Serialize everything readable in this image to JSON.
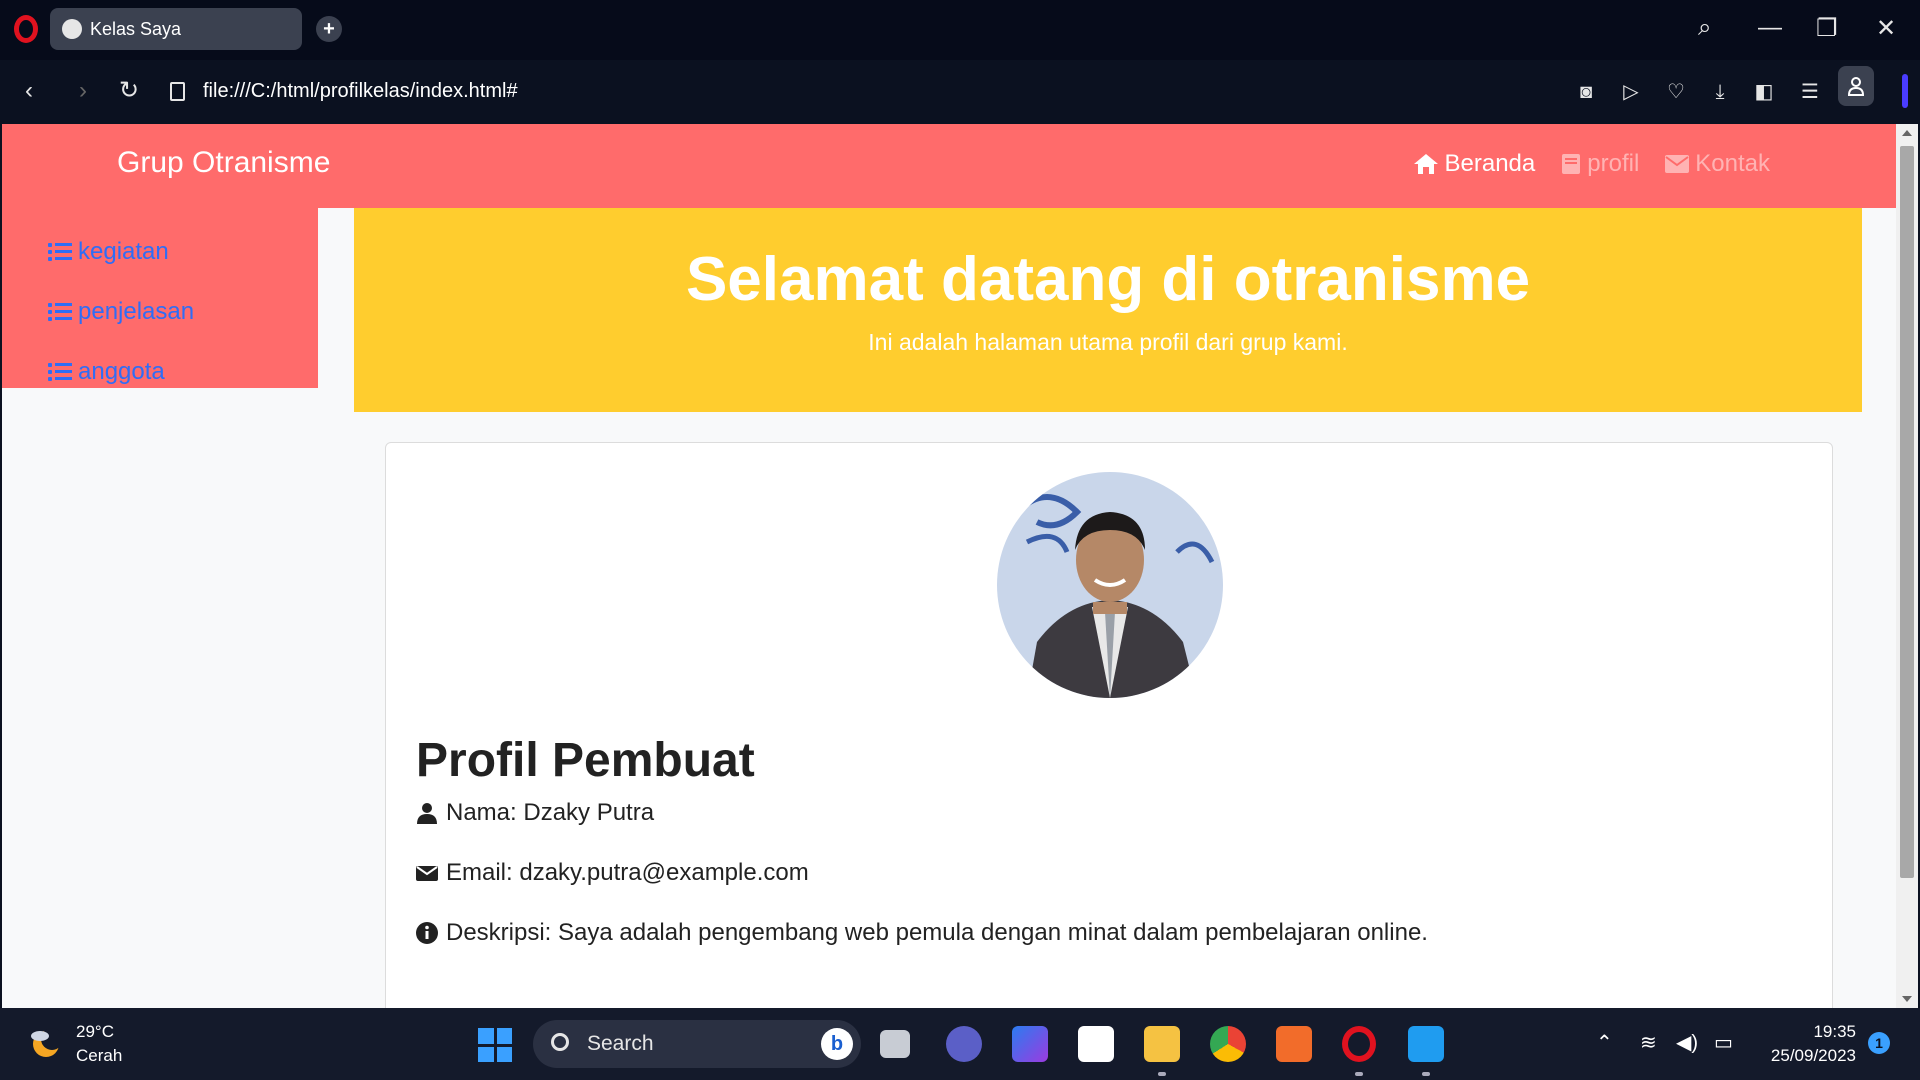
{
  "browser": {
    "tab_title": "Kelas Saya",
    "url": "file:///C:/html/profilkelas/index.html#"
  },
  "site": {
    "brand": "Grup Otranisme",
    "nav": [
      {
        "label": "Beranda",
        "icon": "home-icon",
        "active": true
      },
      {
        "label": "profil",
        "icon": "book-icon",
        "active": false
      },
      {
        "label": "Kontak",
        "icon": "envelope-icon",
        "active": false
      }
    ],
    "sidebar": [
      {
        "label": "kegiatan",
        "icon": "list-icon"
      },
      {
        "label": "penjelasan",
        "icon": "list-icon"
      },
      {
        "label": "anggota",
        "icon": "list-icon"
      }
    ],
    "hero": {
      "title": "Selamat datang di otranisme",
      "subtitle": "Ini adalah halaman utama profil dari grup kami."
    },
    "profile": {
      "heading": "Profil Pembuat",
      "name_line": "Nama: Dzaky Putra",
      "email_line": "Email: dzaky.putra@example.com",
      "desc_line": "Deskripsi: Saya adalah pengembang web pemula dengan minat dalam pembelajaran online."
    },
    "colors": {
      "navbar": "#ff6b6b",
      "hero": "#ffcd2e",
      "link": "#2f6df6"
    }
  },
  "taskbar": {
    "weather_temp": "29°C",
    "weather_cond": "Cerah",
    "search_label": "Search",
    "time": "19:35",
    "date": "25/09/2023",
    "notification_count": "1"
  }
}
